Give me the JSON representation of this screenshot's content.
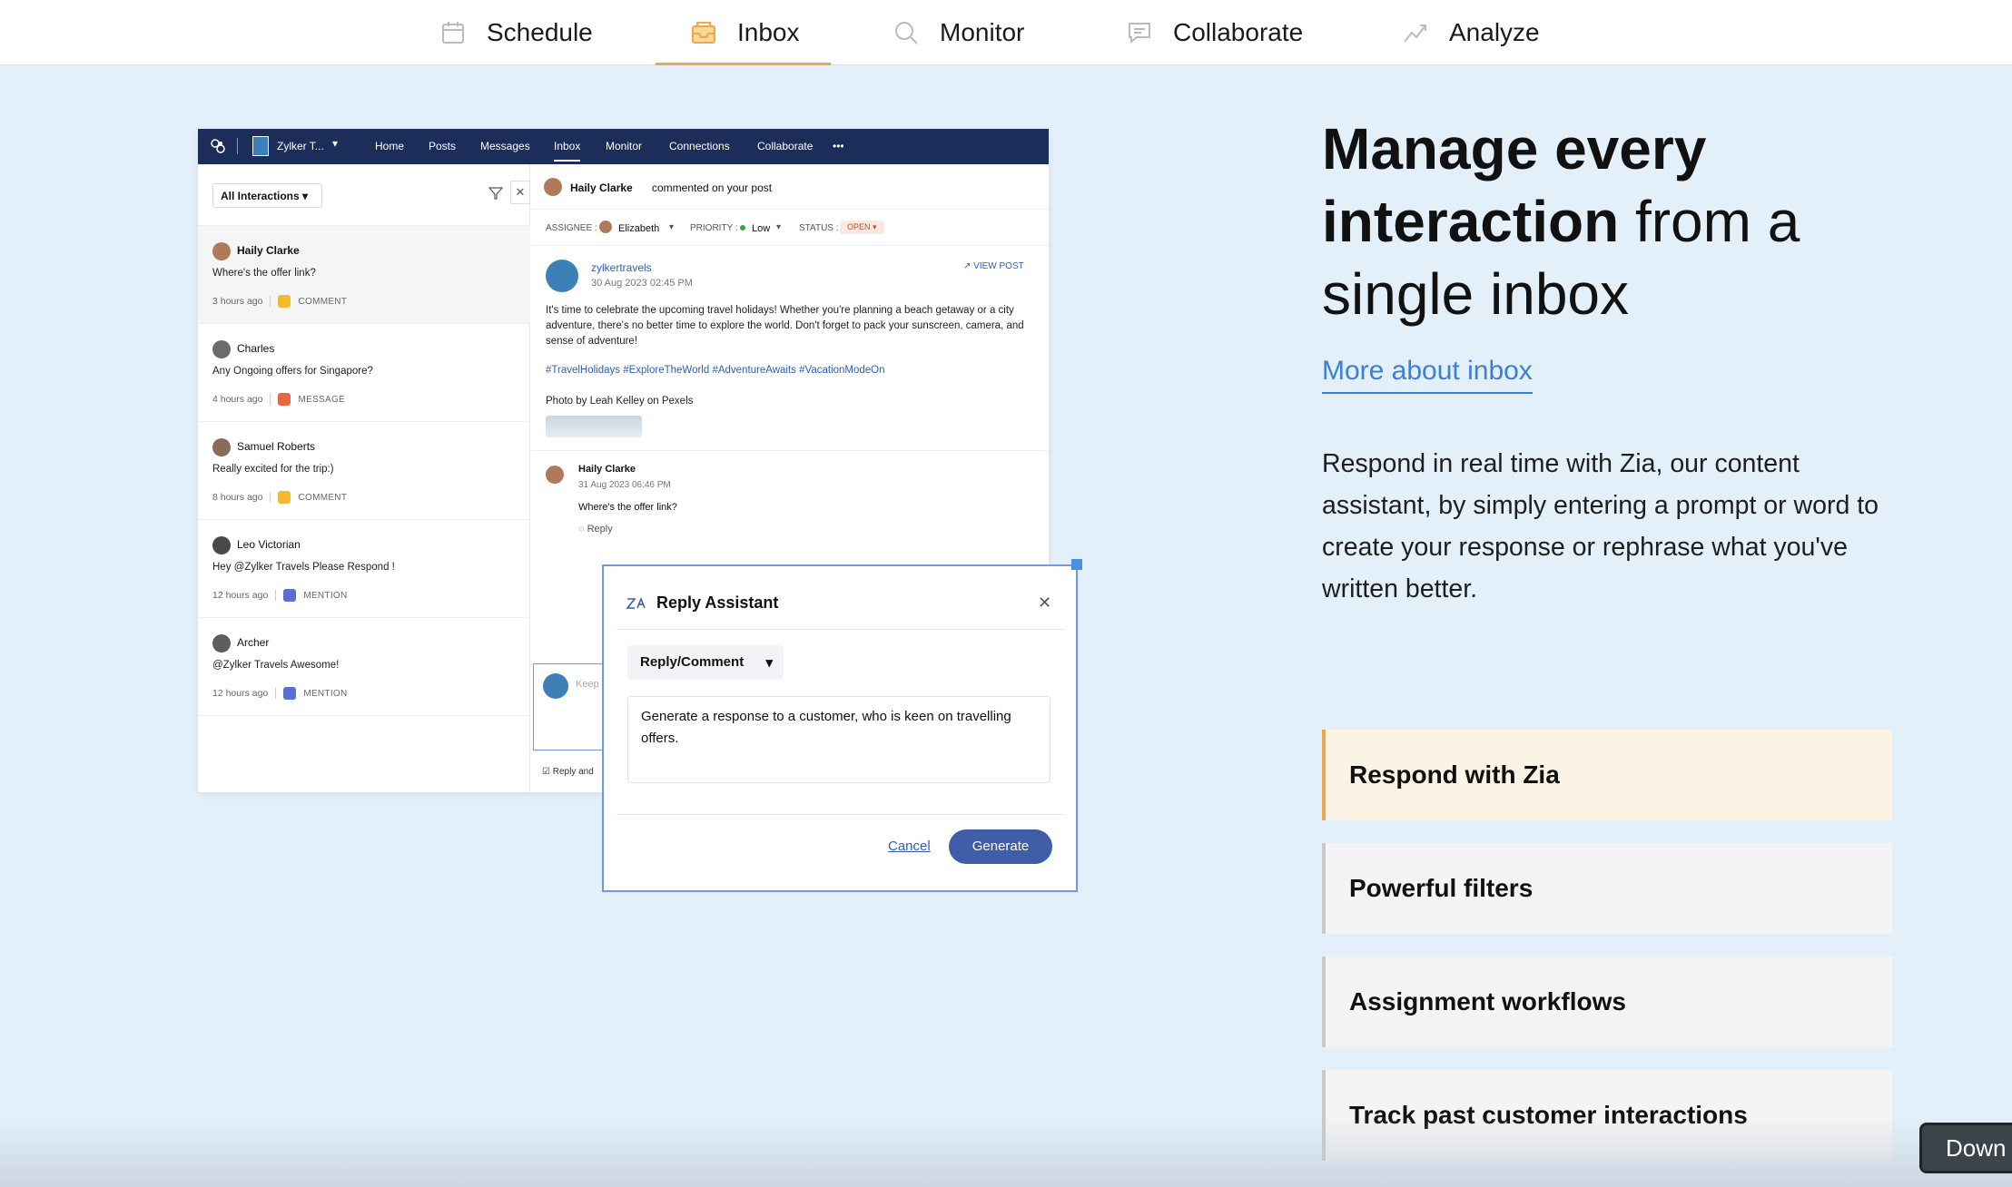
{
  "nav": {
    "tabs": [
      {
        "label": "Schedule",
        "icon": "calendar-icon"
      },
      {
        "label": "Inbox",
        "icon": "inbox-icon",
        "active": true
      },
      {
        "label": "Monitor",
        "icon": "search-icon"
      },
      {
        "label": "Collaborate",
        "icon": "chat-icon"
      },
      {
        "label": "Analyze",
        "icon": "trend-icon"
      }
    ],
    "accent": "#f0a64a"
  },
  "app": {
    "brand": "Zylker T...",
    "menu": [
      "Home",
      "Posts",
      "Messages",
      "Inbox",
      "Monitor",
      "Connections",
      "Collaborate",
      "•••"
    ],
    "filter_label": "All Interactions",
    "conversations": [
      {
        "name": "Haily Clarke",
        "message": "Where's the offer link?",
        "time": "3 hours ago",
        "type": "COMMENT",
        "type_color": "#f5b92e"
      },
      {
        "name": "Charles",
        "message": "Any Ongoing offers for Singapore?",
        "time": "4 hours ago",
        "type": "MESSAGE",
        "type_color": "#e9673f"
      },
      {
        "name": "Samuel Roberts",
        "message": "Really excited for the trip:)",
        "time": "8 hours ago",
        "type": "COMMENT",
        "type_color": "#f5b92e"
      },
      {
        "name": "Leo Victorian",
        "message": "Hey @Zylker Travels Please Respond !",
        "time": "12 hours ago",
        "type": "MENTION",
        "type_color": "#5a6fd6"
      },
      {
        "name": "Archer",
        "message": "@Zylker Travels Awesome!",
        "time": "12 hours ago",
        "type": "MENTION",
        "type_color": "#5a6fd6"
      }
    ],
    "thread": {
      "header_name": "Haily Clarke",
      "header_action": "commented on your post",
      "assignee_label": "ASSIGNEE :",
      "assignee": "Elizabeth",
      "priority_label": "PRIORITY :",
      "priority": "Low",
      "status_label": "STATUS :",
      "status": "OPEN",
      "post_handle": "zylkertravels",
      "post_date": "30 Aug 2023 02:45 PM",
      "view_post": "VIEW POST",
      "post_body": "It's time to celebrate the upcoming travel holidays! Whether you're planning a beach getaway or a city adventure, there's no better time to explore the world. Don't forget to pack your sunscreen, camera, and sense of adventure!",
      "post_tags": "#TravelHolidays #ExploreTheWorld #AdventureAwaits #VacationModeOn",
      "photo_credit": "Photo by Leah Kelley on Pexels",
      "comment_name": "Haily Clarke",
      "comment_date": "31 Aug 2023 06:46 PM",
      "comment_text": "Where's the offer link?",
      "reply_label": "Reply",
      "composer_placeholder": "Keep",
      "reply_and": "Reply and"
    }
  },
  "reply_assistant": {
    "title": "Reply Assistant",
    "mode": "Reply/Comment",
    "prompt": "Generate a response to a customer, who is keen on travelling offers.",
    "cancel": "Cancel",
    "generate": "Generate"
  },
  "hero": {
    "line1_bold": "Manage every",
    "line2_bold": "interaction",
    "line2_rest": " from a",
    "line3": "single inbox",
    "link": "More about inbox",
    "description": "Respond in real time with Zia, our content assistant, by simply entering a prompt or word to create your response or rephrase what you've written better."
  },
  "features": [
    {
      "label": "Respond with Zia",
      "active": true
    },
    {
      "label": "Powerful filters"
    },
    {
      "label": "Assignment workflows"
    },
    {
      "label": "Track past customer interactions"
    }
  ],
  "tooltip": "Down"
}
